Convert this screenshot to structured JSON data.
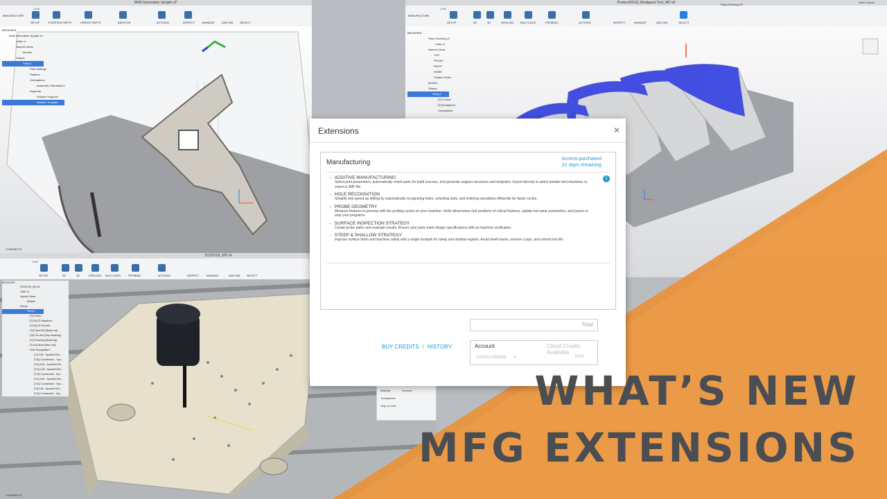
{
  "panes": {
    "top_left": {
      "title": "Whill Generative Upright v2*",
      "workspace": "MANUFACTURE",
      "tab": "CAM",
      "toolbar": [
        "SETUP",
        "POSITION PARTS",
        "ORIENT PARTS",
        "ADDITIVE",
        "ACTIONS",
        "INSPECT",
        "MANAGE",
        "ADD-INS",
        "SELECT"
      ],
      "browser_header": "BROWSER",
      "browser": [
        "Whill Generative Upright v2",
        "Units: in",
        "Named Views",
        "Models",
        "Setups",
        "Setup1",
        "Print Settings",
        "Platform",
        "Orientations",
        "Automatic Orientation1",
        "Supports",
        "Polyline Support1",
        "Additive Toolpath"
      ],
      "comments": "COMMENTS"
    },
    "top_right": {
      "title": "Product#0110_Modguard Tool_MD v6",
      "title2": "Pass Ordering v2*",
      "user": "Marti Owens",
      "workspace": "MANUFACTURE",
      "tab": "CAM",
      "toolbar": [
        "SETUP",
        "2D",
        "3D",
        "DRILLING",
        "MULTI-AXIS",
        "PROBING",
        "ACTIONS",
        "INSPECT",
        "MANAGE",
        "ADD-INS",
        "SELECT"
      ],
      "browser_header": "BROWSER",
      "browser": [
        "Pass Ordering v2",
        "Units: in",
        "Named Views",
        "TOP",
        "FRONT",
        "RIGHT",
        "HOME",
        "Feature Video",
        "Models",
        "Setups",
        "Setup1",
        "[T1] Face1",
        "[T3] Adaptive1",
        "Comparison"
      ],
      "material_label": "Material",
      "material_value": "Ceramic",
      "transparent_label": "Transparent",
      "stop_label": "Stop on colli..."
    },
    "bottom_left": {
      "title": "20120706_MD v6",
      "tab": "CAM",
      "toolbar": [
        "SETUP",
        "2D",
        "3D",
        "DRILLING",
        "MULTI-AXIS",
        "PROBING",
        "ACTIONS",
        "INSPECT",
        "MANAGE",
        "ADD-INS",
        "SELECT"
      ],
      "browser_header": "BROWSER",
      "browser": [
        "20120706_MD v6",
        "Units: in",
        "Named Views",
        "Models",
        "Setups",
        "Setup1",
        "[T1] Face1",
        "[T210] 2D Adaptive1",
        "[T210] 2D Pocket1",
        "[T3] Spot Drill [Rapid out]",
        "[T4] Pre-drill [Chip breaking]",
        "[T1] Reaming [Reaming]",
        "[T1411] Bore [Bore mill]",
        "Hole Recognition1",
        "[T1] Drill - Spotdrill Drill...",
        "[T26] Counterbore - Spo...",
        "[T11] Drill - Spotdrill Drill...",
        "[T12] Drill - Spotdrill Drill...",
        "[T13] Countersink - Spo...",
        "[T11] Drill - Spotdrill Drill...",
        "[T14] Counterbore - Spo...",
        "[T4] Drill - Spotdrill Drill...",
        "[T12] Countersink - Spo..."
      ],
      "comments": "COMMENTS"
    }
  },
  "dialog": {
    "title": "Extensions",
    "close": "✕",
    "panel_title": "Manufacturing",
    "access_status": "Access purchased",
    "access_days": "21 days remaining",
    "extensions": [
      {
        "name": "ADDITIVE MANUFACTURING",
        "desc": "Select print parameters, automatically orient parts for build success, and generate support structures and toolpaths. Export directly to select powder bed machines or export a 3MF file."
      },
      {
        "name": "HOLE RECOGNITION",
        "desc": "Simplify and speed up drilling by automatically recognizing holes, selecting tools, and ordering operations efficiently for faster cycles."
      },
      {
        "name": "PROBE GEOMETRY",
        "desc": "Measure features in-process with the probing cycles on your machine. Verify dimensions and positions of critical features, update tool wear parameters, and pause or stop your programs."
      },
      {
        "name": "SURFACE INSPECTION STRATEGY",
        "desc": "Create probe paths and evaluate results. Ensure your parts meet design specifications with on-machine verification."
      },
      {
        "name": "STEEP & SHALLOW STRATEGY",
        "desc": "Improve surface finish and machine safely with a single toolpath for steep and shallow regions. Avoid dwell marks, remove cusps, and extend tool life."
      }
    ],
    "total_label": "Total",
    "buy_credits": "BUY CREDITS",
    "separator": "/",
    "history": "HISTORY",
    "account_label": "Account",
    "account_number": "1160001436586",
    "credits_label": "Cloud Credits Available",
    "credits_value": "3370"
  },
  "headline": {
    "line1": "WHAT’S NEW",
    "line2": "MFG EXTENSIONS"
  },
  "colors": {
    "accent_orange": "#e8913a",
    "link_blue": "#2196d3",
    "toolpath_blue": "#3340e0",
    "headline_gray": "#4a4d52"
  }
}
